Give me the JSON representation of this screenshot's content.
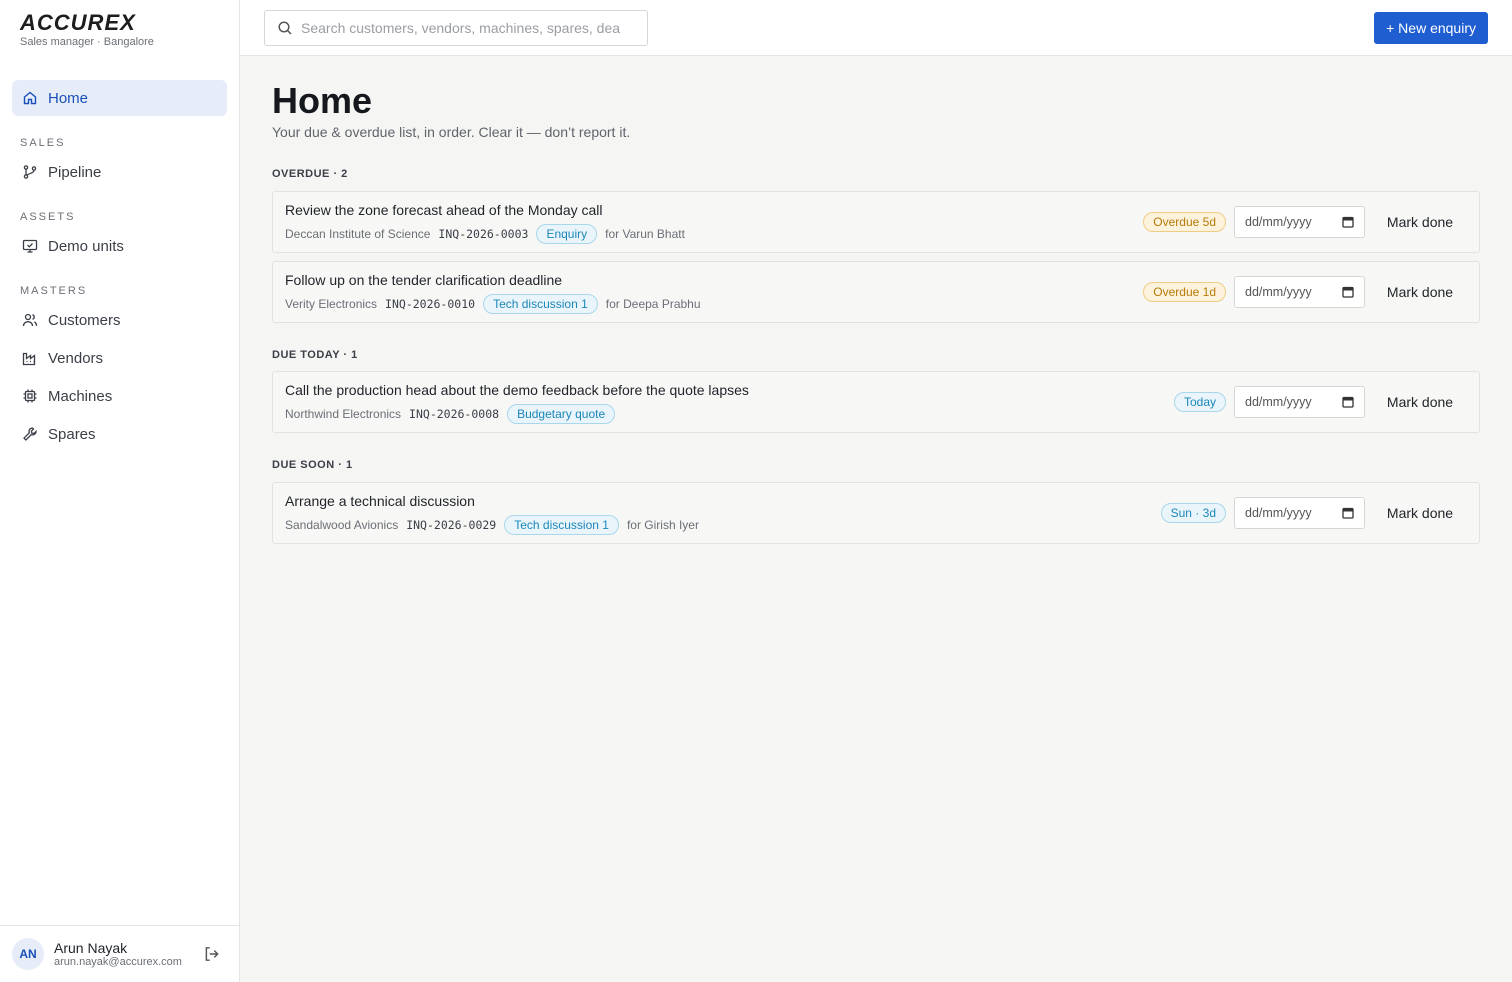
{
  "brand": {
    "logo": "ACCUREX",
    "subtitle": "Sales manager · Bangalore"
  },
  "nav": {
    "home": "Home",
    "sections": {
      "sales": "SALES",
      "assets": "ASSETS",
      "masters": "MASTERS"
    },
    "pipeline": "Pipeline",
    "demo_units": "Demo units",
    "customers": "Customers",
    "vendors": "Vendors",
    "machines": "Machines",
    "spares": "Spares"
  },
  "user": {
    "initials": "AN",
    "name": "Arun Nayak",
    "email": "arun.nayak@accurex.com"
  },
  "search": {
    "placeholder": "Search customers, vendors, machines, spares, dea"
  },
  "topbar": {
    "new_enquiry": "+ New enquiry"
  },
  "page": {
    "title": "Home",
    "subtitle": "Your due & overdue list, in order. Clear it — don’t report it."
  },
  "groups": {
    "overdue": "OVERDUE · 2",
    "due_today": "DUE TODAY · 1",
    "due_soon": "DUE SOON · 1"
  },
  "tasks": [
    {
      "title": "Review the zone forecast ahead of the Monday call",
      "customer": "Deccan Institute of Science",
      "code": "INQ-2026-0003",
      "stage": "Enquiry",
      "owner": "for Varun Bhatt",
      "badge": "Overdue 5d",
      "date_placeholder": "dd/mm/yyyy",
      "action": "Mark done"
    },
    {
      "title": "Follow up on the tender clarification deadline",
      "customer": "Verity Electronics",
      "code": "INQ-2026-0010",
      "stage": "Tech discussion 1",
      "owner": "for Deepa Prabhu",
      "badge": "Overdue 1d",
      "date_placeholder": "dd/mm/yyyy",
      "action": "Mark done"
    },
    {
      "title": "Call the production head about the demo feedback before the quote lapses",
      "customer": "Northwind Electronics",
      "code": "INQ-2026-0008",
      "stage": "Budgetary quote",
      "owner": "",
      "badge": "Today",
      "date_placeholder": "dd/mm/yyyy",
      "action": "Mark done"
    },
    {
      "title": "Arrange a technical discussion",
      "customer": "Sandalwood Avionics",
      "code": "INQ-2026-0029",
      "stage": "Tech discussion 1",
      "owner": "for Girish Iyer",
      "badge": "Sun · 3d",
      "date_placeholder": "dd/mm/yyyy",
      "action": "Mark done"
    }
  ],
  "colors": {
    "accent": "#1f5ed1",
    "overdue": "#b77a0b",
    "info": "#1c86b8"
  }
}
